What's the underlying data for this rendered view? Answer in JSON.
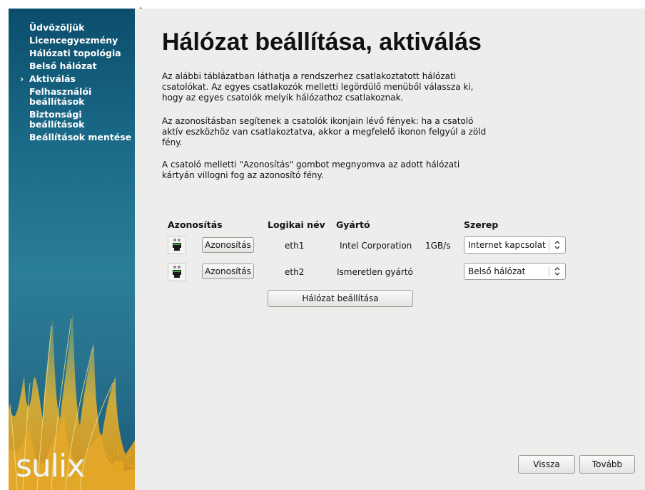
{
  "sidebar": {
    "items": [
      {
        "label": "Üdvözöljük",
        "active": false
      },
      {
        "label": "Licencegyezmény",
        "active": false
      },
      {
        "label": "Hálózati topológia",
        "active": false
      },
      {
        "label": "Belső hálózat",
        "active": false
      },
      {
        "label": "Aktiválás",
        "active": true
      },
      {
        "label": "Felhasználói beállítások",
        "active": false
      },
      {
        "label": "Biztonsági beállítások",
        "active": false
      },
      {
        "label": "Beállítások mentése",
        "active": false
      }
    ],
    "active_marker": "›",
    "logo": "sulix"
  },
  "main": {
    "title": "Hálózat beállítása, aktiválás",
    "paragraphs": [
      "Az alábbi táblázatban láthatja a rendszerhez csatlakoztatott hálózati csatolókat. Az egyes csatlakozók melletti legördülő menüből válassza ki, hogy az egyes csatolók melyik hálózathoz csatlakoznak.",
      "Az azonosításban segítenek a csatolók ikonjain lévő fények: ha a csatoló aktív eszközhöz van csatlakoztatva, akkor a megfelelő ikonon felgyúl a zöld fény.",
      "A csatoló melletti \"Azonosítás\" gombot megnyomva az adott hálózati kártyán villogni fog az azonosító fény."
    ],
    "table": {
      "headers": {
        "identify": "Azonosítás",
        "name": "Logikai név",
        "vendor": "Gyártó",
        "role": "Szerep"
      },
      "rows": [
        {
          "button": "Azonosítás",
          "name": "eth1",
          "vendor": "Intel Corporation",
          "speed": "1GB/s",
          "role": "Internet kapcsolat",
          "light": "off"
        },
        {
          "button": "Azonosítás",
          "name": "eth2",
          "vendor": "Ismeretlen gyártó",
          "speed": "",
          "role": "Belső hálózat",
          "light": "off"
        }
      ]
    },
    "configure_button": "Hálózat beállítása"
  },
  "footer": {
    "back": "Vissza",
    "next": "Tovább"
  },
  "colors": {
    "sidebar": "#1a6a88",
    "background": "#ededec"
  }
}
